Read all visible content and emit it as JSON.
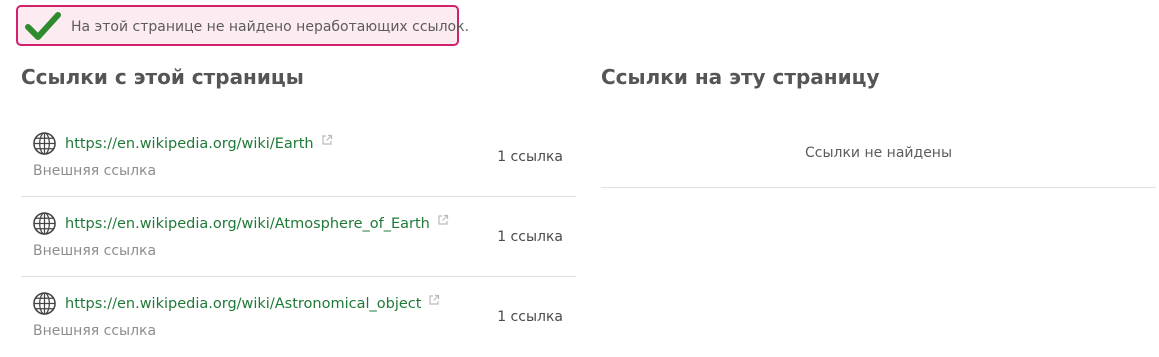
{
  "notice": {
    "message": "На этой странице не найдено неработающих ссылок.",
    "accent_color": "#d2226e",
    "icon": "checkmark-icon"
  },
  "outgoing": {
    "heading": "Ссылки с этой страницы",
    "links": [
      {
        "url": "https://en.wikipedia.org/wiki/Earth",
        "type": "Внешняя ссылка",
        "count": "1 ссылка"
      },
      {
        "url": "https://en.wikipedia.org/wiki/Atmosphere_of_Earth",
        "type": "Внешняя ссылка",
        "count": "1 ссылка"
      },
      {
        "url": "https://en.wikipedia.org/wiki/Astronomical_object",
        "type": "Внешняя ссылка",
        "count": "1 ссылка"
      }
    ]
  },
  "incoming": {
    "heading": "Ссылки на эту страницу",
    "empty_text": "Ссылки не найдены"
  },
  "colors": {
    "link": "#1f7a38",
    "check": "#2e8b2e"
  }
}
